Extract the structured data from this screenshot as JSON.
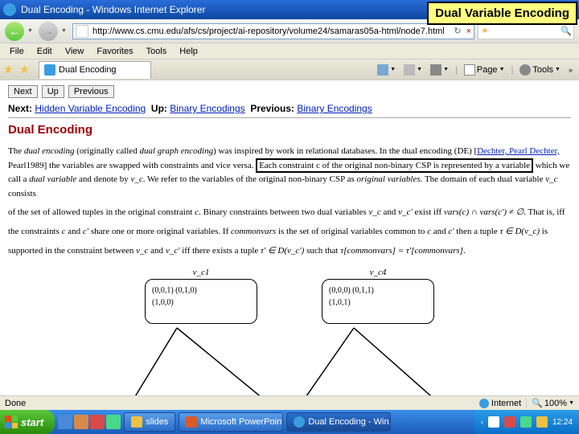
{
  "callout": "Dual Variable Encoding",
  "window": {
    "title": "Dual Encoding - Windows Internet Explorer"
  },
  "address": {
    "url": "http://www.cs.cmu.edu/afs/cs/project/ai-repository/volume24/samaras05a-html/node7.html"
  },
  "menu": {
    "file": "File",
    "edit": "Edit",
    "view": "View",
    "favorites": "Favorites",
    "tools": "Tools",
    "help": "Help"
  },
  "tab": {
    "title": "Dual Encoding"
  },
  "toolbar": {
    "page": "Page",
    "tools": "Tools"
  },
  "content": {
    "btn_next": "Next",
    "btn_up": "Up",
    "btn_prev": "Previous",
    "nav_next_label": "Next:",
    "nav_next_link": "Hidden Variable Encoding",
    "nav_up_label": "Up:",
    "nav_up_link": "Binary Encodings",
    "nav_prev_label": "Previous:",
    "nav_prev_link": "Binary Encodings",
    "heading": "Dual Encoding",
    "p1a": "The ",
    "p1_em1": "dual encoding",
    "p1b": " (originally called ",
    "p1_em2": "dual graph encoding",
    "p1c": ") was inspired by work in relational databases. In the dual encoding (DE) [",
    "p1_cite": "Dechter, Pearl Dechter,",
    "p1d": " Pearl1989] the variables are swapped with constraints and vice versa. ",
    "p1_box": "Each constraint c of the original non-binary CSP is represented by a variable",
    "p1e": " which we call a ",
    "p1_em3": "dual variable",
    "p1f": " and denote by ",
    "p1_var1": "v_c",
    "p1g": ". We refer to the variables of the original non-binary CSP as ",
    "p1_em4": "original variables",
    "p1h": ". The domain of each dual variable ",
    "p1_var2": "v_c",
    "p1i": " consists",
    "p2a": "of the set of allowed tuples in the original constraint ",
    "p2_var1": "c",
    "p2b": ". Binary constraints between two dual variables ",
    "p2_var2": "v_c",
    "p2c": " and ",
    "p2_var3": "v_c'",
    "p2d": " exist iff ",
    "p2_math1": "vars(c) ∩ vars(c') ≠ ∅",
    "p2e": ". That is, iff",
    "p3a": "the constraints ",
    "p3_var1": "c",
    "p3b": " and ",
    "p3_var2": "c'",
    "p3c": " share one or more original variables. If ",
    "p3_em1": "commonvars",
    "p3d": " is the set of original variables common to ",
    "p3_var3": "c",
    "p3e": " and ",
    "p3_var4": "c'",
    "p3f": " then a tuple ",
    "p3_math1": "τ ∈ D(v_c)",
    "p3g": " is",
    "p4a": "supported in the constraint between ",
    "p4_var1": "v_c",
    "p4b": " and ",
    "p4_var2": "v_c'",
    "p4c": " iff there exists a tuple ",
    "p4_math1": "τ' ∈ D(v_c')",
    "p4d": " such that ",
    "p4_math2": "τ[commonvars] = τ'[commonvars]",
    "p4e": ".",
    "fig": {
      "label_left": "v_c1",
      "label_right": "v_c4",
      "box_left_l1": "(0,0,1) (0,1,0)",
      "box_left_l2": "(1,0,0)",
      "box_right_l1": "(0,0,0) (0,1,1)",
      "box_right_l2": "(1,0,1)"
    }
  },
  "status": {
    "done": "Done",
    "zone": "Internet",
    "zoom": "100%"
  },
  "taskbar": {
    "start": "start",
    "task1": "slides",
    "task2": "Microsoft PowerPoint ...",
    "task3": "Dual Encoding - Win...",
    "time": "12:24"
  }
}
